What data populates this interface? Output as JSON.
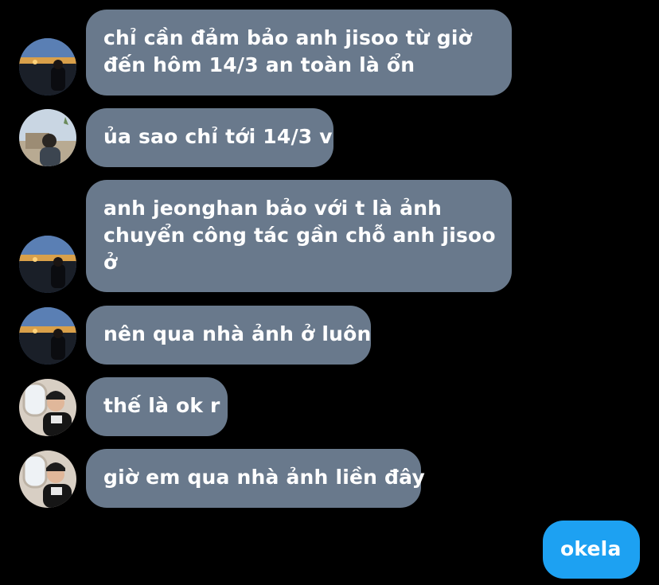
{
  "messages": [
    {
      "side": "in",
      "avatar": "night-city-photo",
      "lines": [
        "chỉ cần đảm bảo anh jisoo từ giờ",
        "đến hôm 14/3 an toàn là ổn"
      ]
    },
    {
      "side": "in",
      "avatar": "outdoor-portrait-photo",
      "lines": [
        "ủa sao chỉ tới 14/3 v"
      ]
    },
    {
      "side": "in",
      "avatar": "night-city-photo",
      "lines": [
        "anh jeonghan bảo với t là ảnh",
        "chuyển công tác gần chỗ anh jisoo",
        "ở"
      ]
    },
    {
      "side": "in",
      "avatar": "night-city-photo",
      "lines": [
        "nên qua nhà ảnh ở luôn"
      ]
    },
    {
      "side": "in",
      "avatar": "airplane-window-selfie",
      "lines": [
        "thế là ok r"
      ]
    },
    {
      "side": "in",
      "avatar": "airplane-window-selfie",
      "lines": [
        "giờ em qua nhà ảnh liền đây"
      ]
    },
    {
      "side": "out",
      "lines": [
        "okela"
      ]
    }
  ],
  "colors": {
    "background": "#000000",
    "incoming_bubble": "#69798c",
    "outgoing_bubble": "#1da1f2",
    "text": "#ffffff"
  }
}
